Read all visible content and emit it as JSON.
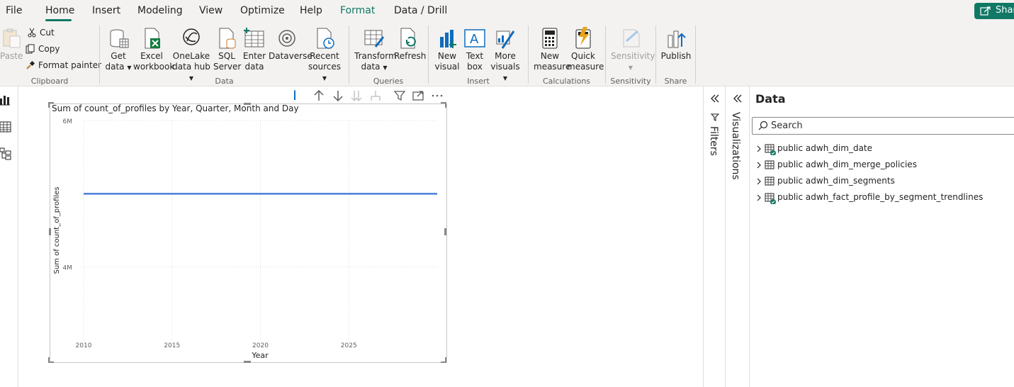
{
  "menu": {
    "items": [
      "File",
      "Home",
      "Insert",
      "Modeling",
      "View",
      "Optimize",
      "Help",
      "Format",
      "Data / Drill"
    ],
    "share_label": "Share"
  },
  "ribbon": {
    "clipboard": {
      "paste": "Paste",
      "cut": "Cut",
      "copy": "Copy",
      "format_painter": "Format painter",
      "group": "Clipboard"
    },
    "data": {
      "get_data_1": "Get",
      "get_data_2": "data",
      "excel_1": "Excel",
      "excel_2": "workbook",
      "onelake_1": "OneLake",
      "onelake_2": "data hub",
      "sql_1": "SQL",
      "sql_2": "Server",
      "enter_1": "Enter",
      "enter_2": "data",
      "dataverse": "Dataverse",
      "recent_1": "Recent",
      "recent_2": "sources",
      "group": "Data"
    },
    "queries": {
      "transform_1": "Transform",
      "transform_2": "data",
      "refresh": "Refresh",
      "group": "Queries"
    },
    "insert": {
      "new_visual_1": "New",
      "new_visual_2": "visual",
      "text_box_1": "Text",
      "text_box_2": "box",
      "more_visuals_1": "More",
      "more_visuals_2": "visuals",
      "group": "Insert"
    },
    "calculations": {
      "new_measure_1": "New",
      "new_measure_2": "measure",
      "quick_measure_1": "Quick",
      "quick_measure_2": "measure",
      "group": "Calculations"
    },
    "sensitivity": {
      "label": "Sensitivity",
      "group": "Sensitivity"
    },
    "share": {
      "publish": "Publish",
      "group": "Share"
    }
  },
  "panes": {
    "filters": "Filters",
    "visualizations": "Visualizations",
    "data_title": "Data",
    "search_placeholder": "Search",
    "tables": [
      {
        "name": "public adwh_dim_date",
        "status": true
      },
      {
        "name": "public adwh_dim_merge_policies",
        "status": false
      },
      {
        "name": "public adwh_dim_segments",
        "status": false
      },
      {
        "name": "public adwh_fact_profile_by_segment_trendlines",
        "status": true
      }
    ]
  },
  "colors": {
    "accent": "#117865",
    "line": "#4a7fd9"
  },
  "chart_data": {
    "type": "line",
    "title": "Sum of count_of_profiles by Year, Quarter, Month and Day",
    "xlabel": "Year",
    "ylabel": "Sum of count_of_profiles",
    "x_ticks": [
      2010,
      2015,
      2020,
      2025
    ],
    "y_ticks": [
      {
        "value": 4000000,
        "label": "4M"
      },
      {
        "value": 6000000,
        "label": "6M"
      }
    ],
    "xlim": [
      2010,
      2030
    ],
    "ylim": [
      3000000,
      6000000
    ],
    "series": [
      {
        "x": [
          2010,
          2030
        ],
        "values": [
          5000000,
          5000000
        ]
      }
    ],
    "grid": true
  }
}
